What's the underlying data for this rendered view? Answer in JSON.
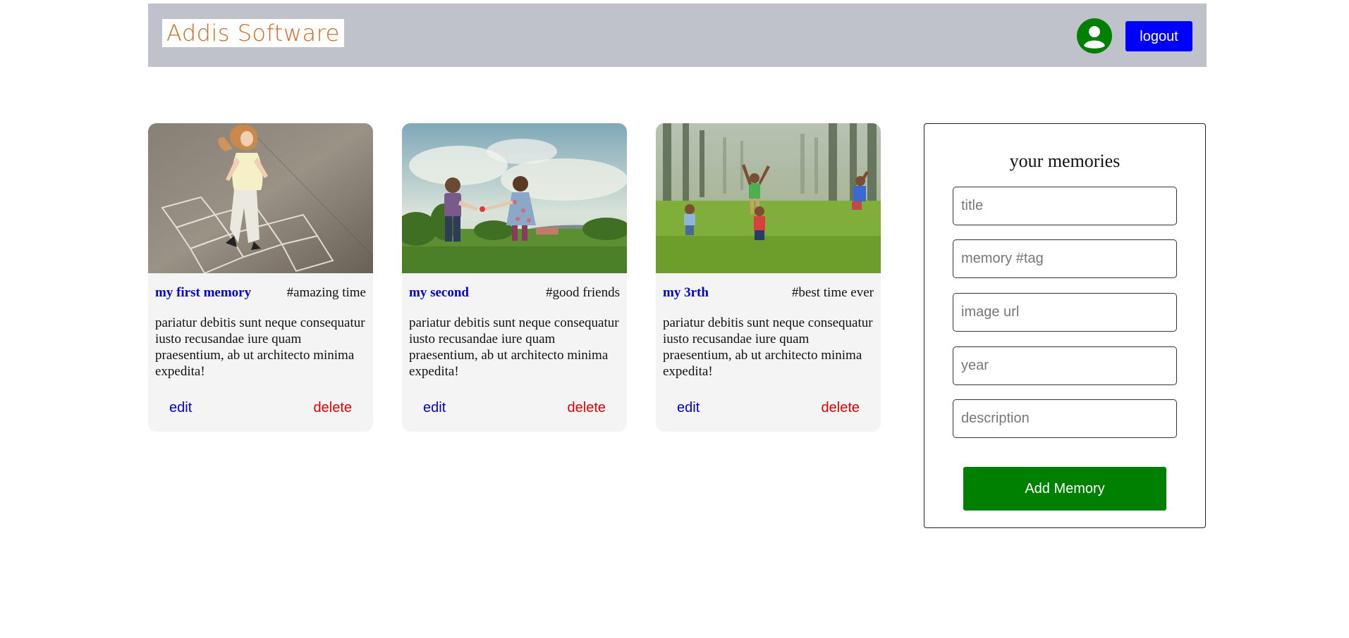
{
  "header": {
    "logo": "Addis Software",
    "logout_label": "logout"
  },
  "colors": {
    "header_bg": "#bfc2ca",
    "logo_text": "#d2691e",
    "avatar": "#008000",
    "logout_bg": "#0000ff",
    "title_link": "#0000d8",
    "delete": "#e00000",
    "add_button": "#008000"
  },
  "memories": [
    {
      "title": "my first memory",
      "tag": "#amazing time",
      "description": "pariatur debitis sunt neque consequatur iusto recusandae iure quam praesentium, ab ut architecto minima expedita!",
      "image": "girl playing hopscotch",
      "edit_label": "edit",
      "delete_label": "delete"
    },
    {
      "title": "my second",
      "tag": "#good friends",
      "description": "pariatur debitis sunt neque consequatur iusto recusandae iure quam praesentium, ab ut architecto minima expedita!",
      "image": "two children holding hands on grass",
      "edit_label": "edit",
      "delete_label": "delete"
    },
    {
      "title": "my 3rth",
      "tag": "#best time ever",
      "description": "pariatur debitis sunt neque consequatur iusto recusandae iure quam praesentium, ab ut architecto minima expedita!",
      "image": "children jumping in a forest meadow",
      "edit_label": "edit",
      "delete_label": "delete"
    }
  ],
  "form": {
    "heading": "your memories",
    "title_placeholder": "title",
    "tag_placeholder": "memory #tag",
    "image_placeholder": "image url",
    "year_placeholder": "year",
    "description_placeholder": "description",
    "submit_label": "Add Memory"
  }
}
